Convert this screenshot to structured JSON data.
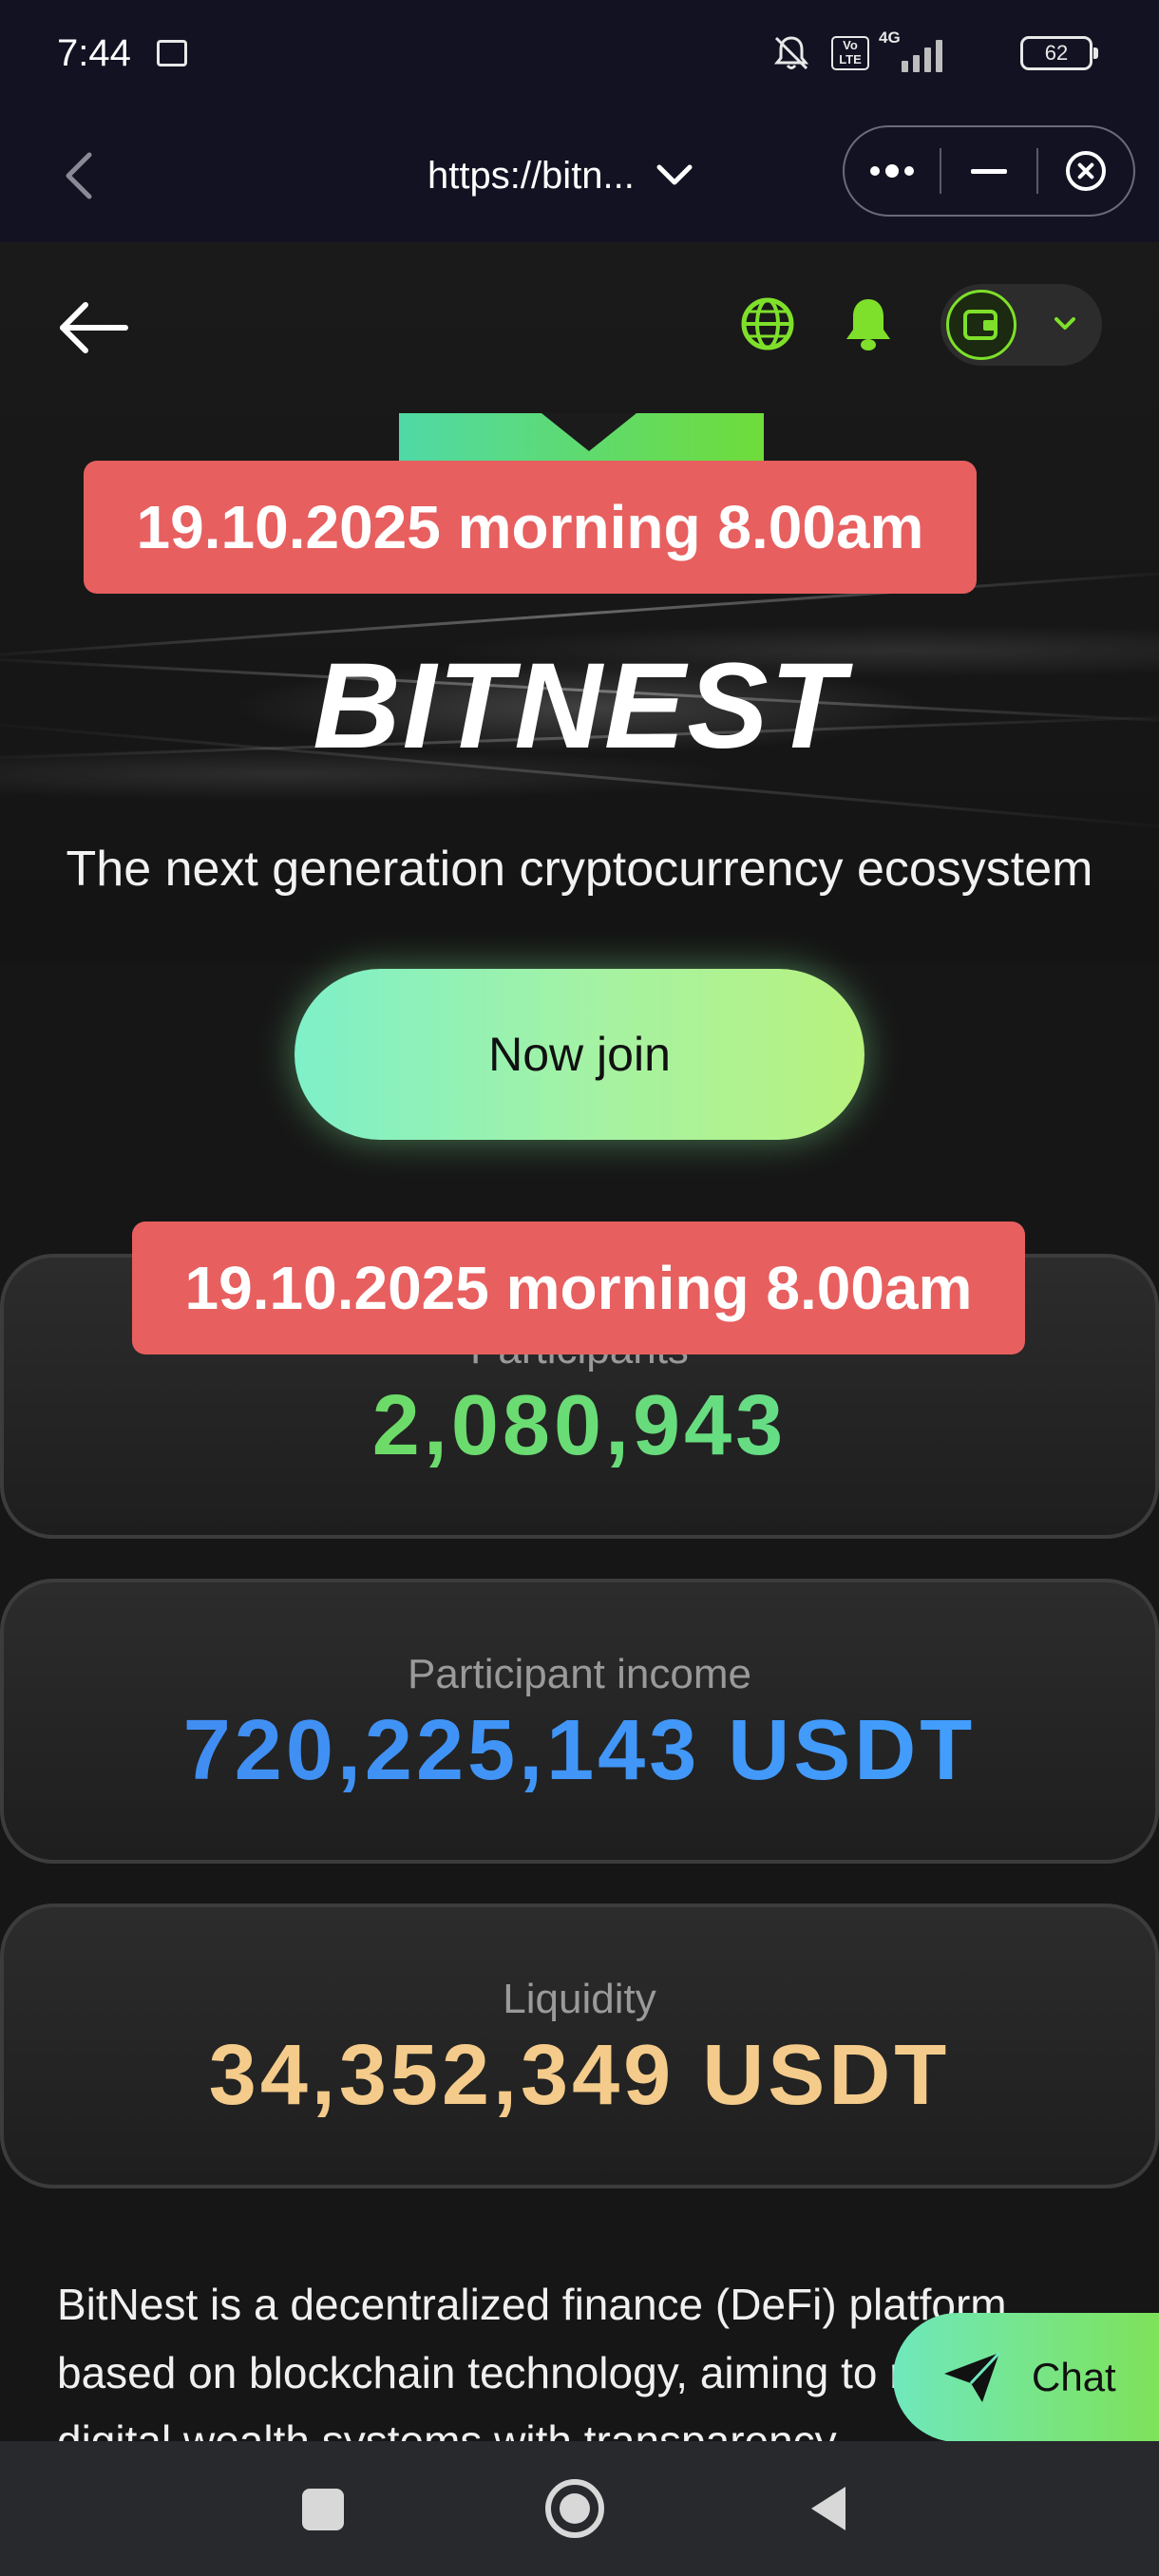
{
  "status_bar": {
    "time": "7:44",
    "volte_label": "Vo LTE",
    "network_label": "4G",
    "battery_level": "62"
  },
  "browser": {
    "url": "https://bitn...",
    "icons": [
      "back-arrow-icon",
      "chevron-down-icon",
      "more-icon",
      "minimize-icon",
      "close-icon"
    ]
  },
  "header": {
    "icons": [
      "back-arrow-icon",
      "globe-icon",
      "bell-icon",
      "wallet-icon",
      "chevron-down-icon"
    ],
    "accent_color": "#7ee02a"
  },
  "hero": {
    "brand": "BITNEST",
    "tagline": "The next generation cryptocurrency ecosystem",
    "join_label": "Now join"
  },
  "overlay": {
    "banner_top": "19.10.2025 morning 8.00am",
    "banner_middle": "19.10.2025 morning 8.00am",
    "banner_color": "#e75f5f"
  },
  "stats": [
    {
      "label": "Participants",
      "value": "2,080,943"
    },
    {
      "label": "Participant income",
      "value": "720,225,143 USDT"
    },
    {
      "label": "Liquidity",
      "value": "34,352,349 USDT"
    }
  ],
  "description": "BitNest is a decentralized finance (DeFi) platform based on blockchain technology, aiming to redistribute digital wealth systems with transparency",
  "chat": {
    "label": "Chat"
  },
  "nav": {
    "icons": [
      "recent-apps-icon",
      "home-icon",
      "back-icon"
    ]
  }
}
